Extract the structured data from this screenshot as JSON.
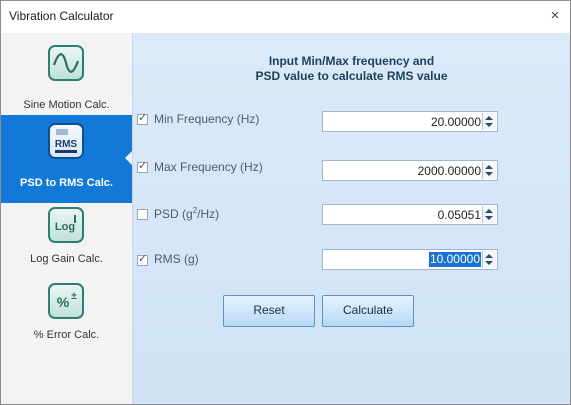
{
  "window": {
    "title": "Vibration Calculator",
    "close_glyph": "×"
  },
  "sidebar": {
    "items": [
      {
        "label": "Sine Motion Calc.",
        "icon": "sine-wave-icon",
        "active": false
      },
      {
        "label": "PSD to RMS Calc.",
        "icon": "psd-rms-icon",
        "icon_text": "RMS",
        "active": true
      },
      {
        "label": "Log Gain Calc.",
        "icon": "log-gain-icon",
        "icon_text": "Log",
        "active": false
      },
      {
        "label": "% Error Calc.",
        "icon": "percent-error-icon",
        "icon_text": "%",
        "active": false
      }
    ]
  },
  "main": {
    "heading_line1": "Input Min/Max frequency and",
    "heading_line2": "PSD value to calculate RMS value",
    "rows": [
      {
        "label": "Min Frequency (Hz)",
        "checked": true,
        "value": "20.00000"
      },
      {
        "label": "Max Frequency (Hz)",
        "checked": true,
        "value": "2000.00000"
      },
      {
        "label_prefix": "PSD (g",
        "label_sup": "2",
        "label_suffix": "/Hz)",
        "checked": false,
        "value": "0.05051"
      },
      {
        "label": "RMS (g)",
        "checked": true,
        "value": "10.00000"
      }
    ],
    "reset_label": "Reset",
    "calculate_label": "Calculate"
  },
  "colors": {
    "accent": "#1379d8",
    "panel": "#d6e7f8",
    "icon_border": "#2f7e74"
  }
}
